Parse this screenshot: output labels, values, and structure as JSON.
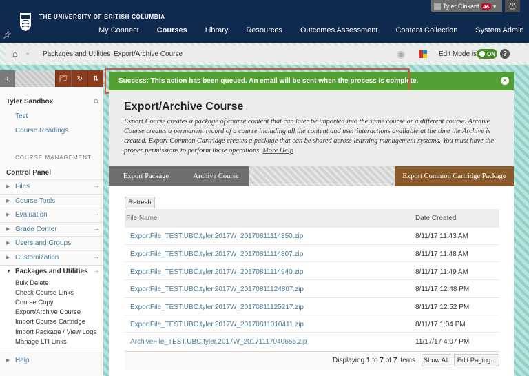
{
  "header": {
    "institution": "THE UNIVERSITY OF BRITISH COLUMBIA",
    "logo_text": "UBC",
    "nav": [
      "My Connect",
      "Courses",
      "Library",
      "Resources",
      "Outcomes Assessment",
      "Content Collection",
      "System Admin"
    ],
    "active_nav": "Courses",
    "user_name": "Tyler Cinkant",
    "notification_count": "46"
  },
  "breadcrumb": {
    "items": [
      "Packages and Utilities",
      "Export/Archive Course"
    ],
    "edit_mode_label": "Edit Mode is:",
    "edit_mode_value": "ON"
  },
  "sidebar": {
    "course_name": "Tyler Sandbox",
    "links": [
      "Test",
      "Course Readings"
    ],
    "management_label": "COURSE MANAGEMENT",
    "control_panel": "Control Panel",
    "items": [
      "Files",
      "Course Tools",
      "Evaluation",
      "Grade Center",
      "Users and Groups",
      "Customization",
      "Packages and Utilities"
    ],
    "sub_items": [
      "Bulk Delete",
      "Check Course Links",
      "Course Copy",
      "Export/Archive Course",
      "Import Course Cartridge",
      "Import Package / View Logs",
      "Manage LTI Links"
    ],
    "help": "Help"
  },
  "banner": {
    "message": "Success: This action has been queued. An email will be sent when the process is complete."
  },
  "page": {
    "title": "Export/Archive Course",
    "description": "Export Course creates a package of course content that can later be imported into the same course or a different course. Archive Course creates a permanent record of a course including all the content and user interactions available at the time the Archive is created. Export Common Cartridge creates a package that can be shared across learning management systems. You must have the proper permissions to perform these operations.",
    "more_help": "More Help",
    "tabs": [
      "Export Package",
      "Archive Course",
      "Export Common Cartridge Package"
    ],
    "refresh": "Refresh",
    "columns": [
      "File Name",
      "Date Created"
    ],
    "rows": [
      {
        "file": "ExportFile_TEST.UBC.tyler.2017W_20170811114350.zip",
        "date": "8/11/17 11:43 AM"
      },
      {
        "file": "ExportFile_TEST.UBC.tyler.2017W_20170811114807.zip",
        "date": "8/11/17 11:48 AM"
      },
      {
        "file": "ExportFile_TEST.UBC.tyler.2017W_20170811114940.zip",
        "date": "8/11/17 11:49 AM"
      },
      {
        "file": "ExportFile_TEST.UBC.tyler.2017W_20170811124807.zip",
        "date": "8/11/17 12:48 PM"
      },
      {
        "file": "ExportFile_TEST.UBC.tyler.2017W_20170811125217.zip",
        "date": "8/11/17 12:52 PM"
      },
      {
        "file": "ExportFile_TEST.UBC.tyler.2017W_20170811010411.zip",
        "date": "8/11/17 1:04 PM"
      },
      {
        "file": "ArchiveFile_TEST.UBC.tyler.2017W_20171117040655.zip",
        "date": "11/17/17 4:07 PM"
      }
    ],
    "displaying": "Displaying",
    "range_from": "1",
    "range_to": "7",
    "total": "7",
    "items_word": "items",
    "show_all": "Show All",
    "edit_paging": "Edit Paging..."
  }
}
